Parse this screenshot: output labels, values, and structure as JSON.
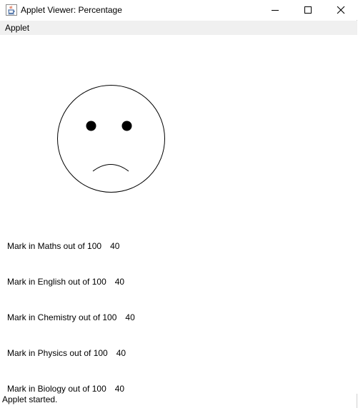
{
  "window": {
    "title": "Applet Viewer: Percentage",
    "icon": "java-coffee-cup-icon"
  },
  "menu": {
    "items": [
      {
        "label": "Applet"
      }
    ]
  },
  "face": {
    "expression": "sad"
  },
  "marks": [
    {
      "label": "Mark in Maths out of 100",
      "value": "40"
    },
    {
      "label": "Mark in English out of 100",
      "value": "40"
    },
    {
      "label": "Mark in Chemistry out of 100",
      "value": "40"
    },
    {
      "label": "Mark in Physics out of 100",
      "value": "40"
    },
    {
      "label": "Mark in Biology out of 100",
      "value": "40"
    }
  ],
  "status": "Applet started.",
  "colors": {
    "menubar": "#f0f0f0",
    "canvas": "#ffffff",
    "ink": "#000000"
  }
}
